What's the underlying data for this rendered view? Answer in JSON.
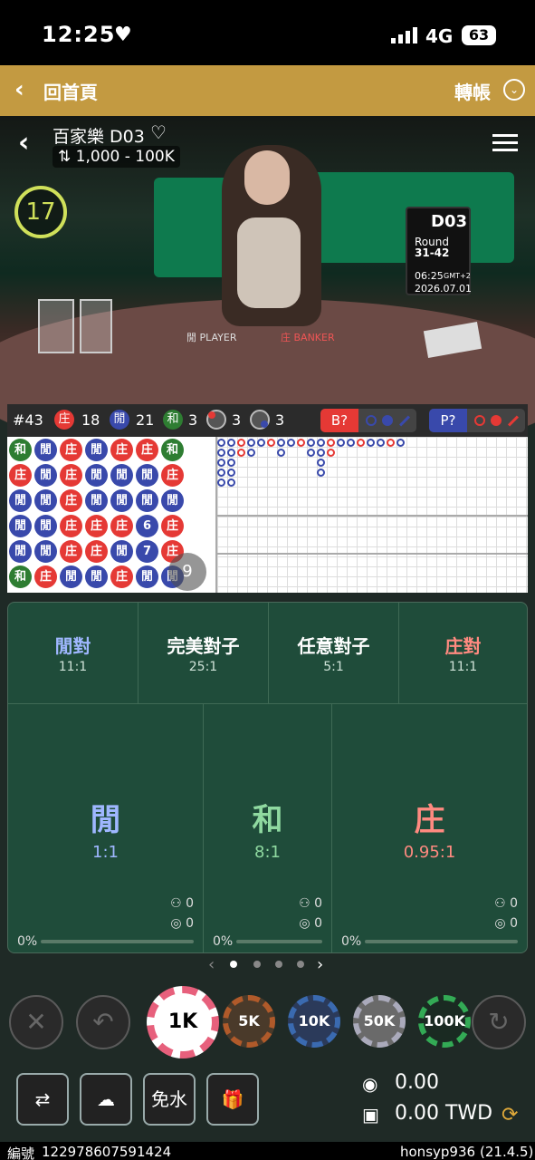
{
  "status_bar": {
    "time": "12:25",
    "network": "4G",
    "battery": "63"
  },
  "header": {
    "back_label": "回首頁",
    "transfer_label": "轉帳"
  },
  "table_info": {
    "title": "百家樂 D03",
    "limits": "1,000 - 100K",
    "countdown": "17",
    "screen_table": "D03",
    "screen_round_label": "Round",
    "screen_round": "31-42",
    "screen_time": "06:25",
    "screen_tz": "GMT+2",
    "screen_date": "2026.07.01",
    "felt_player": "閒 PLAYER",
    "felt_banker": "庄 BANKER"
  },
  "road_stats": {
    "shoe": "#43",
    "banker_sym": "庄",
    "banker": "18",
    "player_sym": "閒",
    "player": "21",
    "tie_sym": "和",
    "tie": "3",
    "banker_pair": "3",
    "player_pair": "3",
    "banker_ask": "B?",
    "player_ask": "P?",
    "bead_count": "9"
  },
  "bead_road": [
    [
      "和",
      "庄",
      "閒",
      "閒",
      "閒",
      "和"
    ],
    [
      "閒",
      "閒",
      "閒",
      "閒",
      "閒",
      "庄"
    ],
    [
      "庄",
      "庄",
      "庄",
      "庄",
      "庄",
      "閒"
    ],
    [
      "閒",
      "閒",
      "閒",
      "庄",
      "庄",
      "閒"
    ],
    [
      "庄",
      "閒",
      "閒",
      "庄",
      "閒",
      "庄"
    ],
    [
      "庄",
      "閒",
      "閒",
      "6",
      "7",
      "閒"
    ],
    [
      "和",
      "庄",
      "閒",
      "庄",
      "庄",
      "閒"
    ]
  ],
  "bets": {
    "player_pair": {
      "name": "閒對",
      "odds": "11:1"
    },
    "perfect_pair": {
      "name": "完美對子",
      "odds": "25:1"
    },
    "either_pair": {
      "name": "任意對子",
      "odds": "5:1"
    },
    "banker_pair": {
      "name": "庄對",
      "odds": "11:1"
    },
    "player": {
      "name": "閒",
      "odds": "1:1",
      "users": "0",
      "chips": "0",
      "pct": "0%"
    },
    "tie": {
      "name": "和",
      "odds": "8:1",
      "users": "0",
      "chips": "0",
      "pct": "0%"
    },
    "banker": {
      "name": "庄",
      "odds": "0.95:1",
      "users": "0",
      "chips": "0",
      "pct": "0%"
    }
  },
  "chips": [
    "1K",
    "5K",
    "10K",
    "50K",
    "100K"
  ],
  "bottom": {
    "no_commission": "免水",
    "balance": "0.00",
    "currency_balance": "0.00 TWD"
  },
  "footer": {
    "id_label": "編號",
    "id": "122978607591424",
    "user": "honsyp936",
    "version": "(21.4.5)"
  },
  "colors": {
    "banker": "#e53935",
    "player": "#3949ab",
    "tie": "#2e7d32",
    "gold": "#c39a41"
  }
}
